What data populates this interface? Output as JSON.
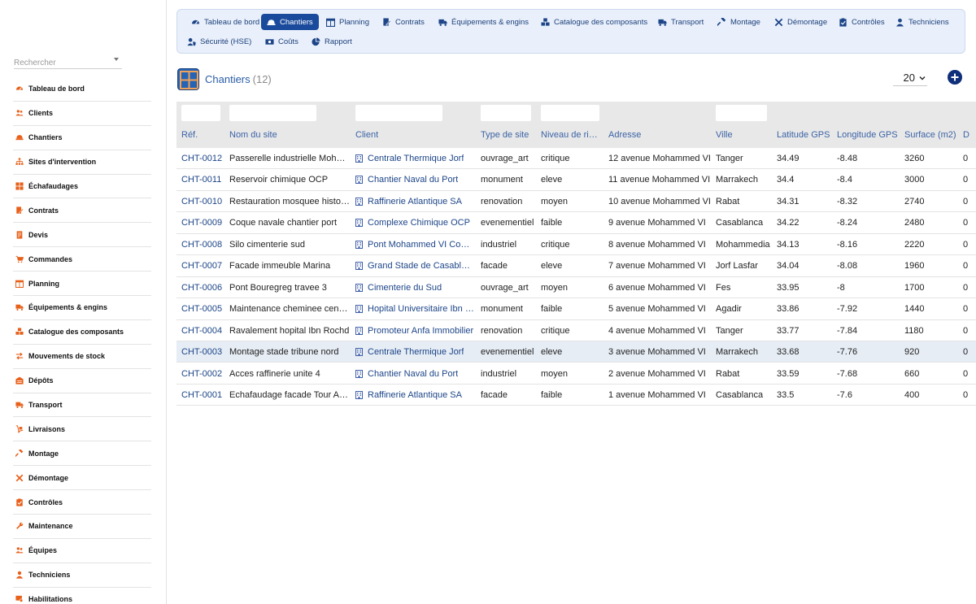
{
  "colors": {
    "accent": "#1a4a9c",
    "link": "#1d4588",
    "icon_orange": "#e8601a",
    "nav_bg": "#e9f0fb"
  },
  "search": {
    "placeholder": "Rechercher"
  },
  "sidebar": {
    "items": [
      {
        "label": "Tableau de bord",
        "icon": "dashboard-icon"
      },
      {
        "label": "Clients",
        "icon": "users-icon"
      },
      {
        "label": "Chantiers",
        "icon": "hard-hat-icon"
      },
      {
        "label": "Sites d'intervention",
        "icon": "sitemap-icon"
      },
      {
        "label": "Échafaudages",
        "icon": "grid-icon"
      },
      {
        "label": "Contrats",
        "icon": "contract-icon"
      },
      {
        "label": "Devis",
        "icon": "invoice-icon"
      },
      {
        "label": "Commandes",
        "icon": "cart-icon"
      },
      {
        "label": "Planning",
        "icon": "calendar-icon"
      },
      {
        "label": "Équipements & engins",
        "icon": "truck-icon"
      },
      {
        "label": "Catalogue des composants",
        "icon": "cubes-icon"
      },
      {
        "label": "Mouvements de stock",
        "icon": "exchange-icon"
      },
      {
        "label": "Dépôts",
        "icon": "warehouse-icon"
      },
      {
        "label": "Transport",
        "icon": "truck-icon"
      },
      {
        "label": "Livraisons",
        "icon": "dolly-icon"
      },
      {
        "label": "Montage",
        "icon": "hammer-icon"
      },
      {
        "label": "Démontage",
        "icon": "tools-icon"
      },
      {
        "label": "Contrôles",
        "icon": "clipboard-check-icon"
      },
      {
        "label": "Maintenance",
        "icon": "wrench-icon"
      },
      {
        "label": "Équipes",
        "icon": "users-icon"
      },
      {
        "label": "Techniciens",
        "icon": "user-icon"
      },
      {
        "label": "Habilitations",
        "icon": "certificate-icon"
      }
    ]
  },
  "topnav": {
    "items": [
      {
        "label": "Tableau de bord",
        "icon": "dashboard-icon"
      },
      {
        "label": "Chantiers",
        "icon": "hard-hat-icon"
      },
      {
        "label": "Planning",
        "icon": "calendar-icon"
      },
      {
        "label": "Contrats",
        "icon": "contract-icon"
      },
      {
        "label": "Équipements & engins",
        "icon": "truck-icon"
      },
      {
        "label": "Catalogue des composants",
        "icon": "cubes-icon"
      },
      {
        "label": "Transport",
        "icon": "truck-icon"
      },
      {
        "label": "Montage",
        "icon": "hammer-icon"
      },
      {
        "label": "Démontage",
        "icon": "tools-icon"
      },
      {
        "label": "Contrôles",
        "icon": "clipboard-check-icon"
      },
      {
        "label": "Techniciens",
        "icon": "user-icon"
      },
      {
        "label": "Sécurité (HSE)",
        "icon": "user-shield-icon"
      },
      {
        "label": "Coûts",
        "icon": "money-icon"
      },
      {
        "label": "Rapport",
        "icon": "chart-pie-icon"
      }
    ],
    "active": "Chantiers"
  },
  "header": {
    "title": "Chantiers",
    "count": "(12)",
    "page_size": "20"
  },
  "table": {
    "columns": [
      "Réf.",
      "Nom du site",
      "Client",
      "Type de site",
      "Niveau de ri…",
      "Adresse",
      "Ville",
      "Latitude GPS",
      "Longitude GPS",
      "Surface (m2)",
      "D"
    ],
    "rows": [
      [
        "CHT-0012",
        "Passerelle industrielle Moha…",
        "Centrale Thermique Jorf",
        "ouvrage_art",
        "critique",
        "12 avenue Mohammed VI",
        "Tanger",
        "34.49",
        "-8.48",
        "3260",
        "0"
      ],
      [
        "CHT-0011",
        "Reservoir chimique OCP",
        "Chantier Naval du Port",
        "monument",
        "eleve",
        "11 avenue Mohammed VI",
        "Marrakech",
        "34.4",
        "-8.4",
        "3000",
        "0"
      ],
      [
        "CHT-0010",
        "Restauration mosquee histo…",
        "Raffinerie Atlantique SA",
        "renovation",
        "moyen",
        "10 avenue Mohammed VI",
        "Rabat",
        "34.31",
        "-8.32",
        "2740",
        "0"
      ],
      [
        "CHT-0009",
        "Coque navale chantier port",
        "Complexe Chimique OCP",
        "evenementiel",
        "faible",
        "9 avenue Mohammed VI",
        "Casablanca",
        "34.22",
        "-8.24",
        "2480",
        "0"
      ],
      [
        "CHT-0008",
        "Silo cimenterie sud",
        "Pont Mohammed VI Con…",
        "industriel",
        "critique",
        "8 avenue Mohammed VI",
        "Mohammedia",
        "34.13",
        "-8.16",
        "2220",
        "0"
      ],
      [
        "CHT-0007",
        "Facade immeuble Marina",
        "Grand Stade de Casabla…",
        "facade",
        "eleve",
        "7 avenue Mohammed VI",
        "Jorf Lasfar",
        "34.04",
        "-8.08",
        "1960",
        "0"
      ],
      [
        "CHT-0006",
        "Pont Bouregreg travee 3",
        "Cimenterie du Sud",
        "ouvrage_art",
        "moyen",
        "6 avenue Mohammed VI",
        "Fes",
        "33.95",
        "-8",
        "1700",
        "0"
      ],
      [
        "CHT-0005",
        "Maintenance cheminee cent…",
        "Hopital Universitaire Ibn …",
        "monument",
        "faible",
        "5 avenue Mohammed VI",
        "Agadir",
        "33.86",
        "-7.92",
        "1440",
        "0"
      ],
      [
        "CHT-0004",
        "Ravalement hopital Ibn Rochd",
        "Promoteur Anfa Immobilier",
        "renovation",
        "critique",
        "4 avenue Mohammed VI",
        "Tanger",
        "33.77",
        "-7.84",
        "1180",
        "0"
      ],
      [
        "CHT-0003",
        "Montage stade tribune nord",
        "Centrale Thermique Jorf",
        "evenementiel",
        "eleve",
        "3 avenue Mohammed VI",
        "Marrakech",
        "33.68",
        "-7.76",
        "920",
        "0"
      ],
      [
        "CHT-0002",
        "Acces raffinerie unite 4",
        "Chantier Naval du Port",
        "industriel",
        "moyen",
        "2 avenue Mohammed VI",
        "Rabat",
        "33.59",
        "-7.68",
        "660",
        "0"
      ],
      [
        "CHT-0001",
        "Echafaudage facade Tour A…",
        "Raffinerie Atlantique SA",
        "facade",
        "faible",
        "1 avenue Mohammed VI",
        "Casablanca",
        "33.5",
        "-7.6",
        "400",
        "0"
      ]
    ],
    "highlighted_row": "CHT-0003"
  }
}
